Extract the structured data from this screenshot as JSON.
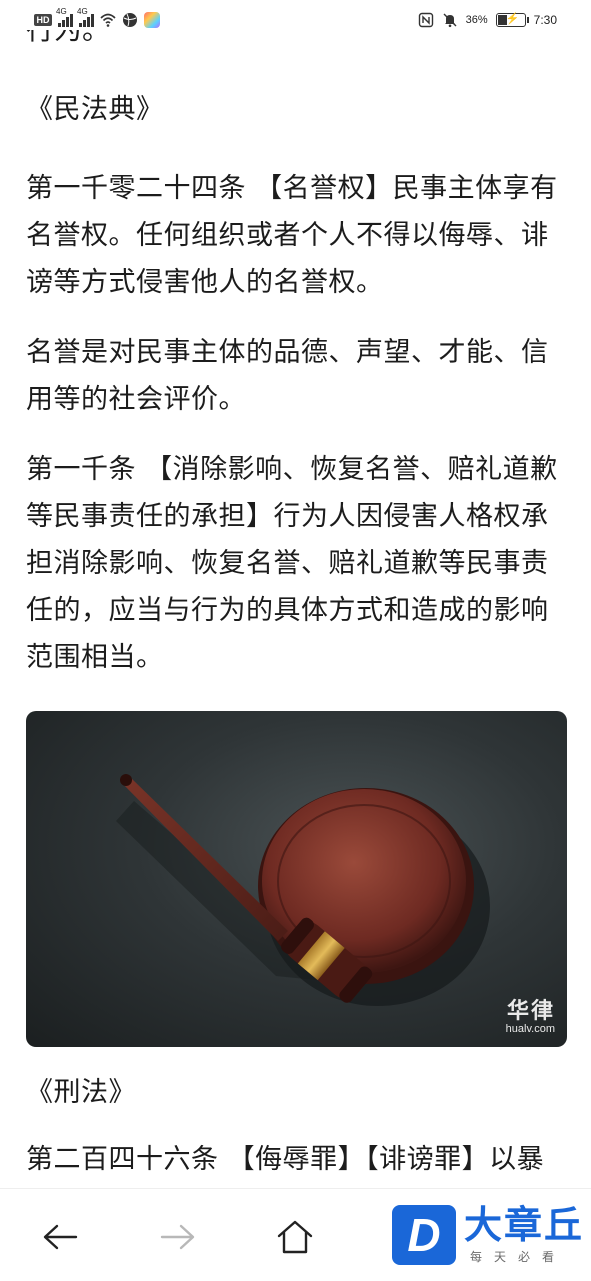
{
  "status_bar": {
    "hd_label": "HD",
    "sim1_label": "4G",
    "sim2_label": "4G",
    "battery_text": "36%",
    "time": "7:30"
  },
  "article": {
    "cut_text": "行为。",
    "book1": "《民法典》",
    "p1": "第一千零二十四条 【名誉权】民事主体享有名誉权。任何组织或者个人不得以侮辱、诽谤等方式侵害他人的名誉权。",
    "p2": "名誉是对民事主体的品德、声望、才能、信用等的社会评价。",
    "p3": "第一千条 【消除影响、恢复名誉、赔礼道歉等民事责任的承担】行为人因侵害人格权承担消除影响、恢复名誉、赔礼道歉等民事责任的，应当与行为的具体方式和造成的影响范围相当。",
    "image_watermark_cn": "华律",
    "image_watermark_en": "hualv.com",
    "book2": "《刑法》",
    "p4": "第二百四十六条 【侮辱罪】【诽谤罪】以暴力或者其他方法公然侮辱他人或者捏造"
  },
  "bottom_bar": {
    "back_icon": "arrow-left-icon",
    "forward_icon": "arrow-right-icon",
    "home_icon": "home-icon",
    "logo_letter": "D",
    "logo_name": "大章丘",
    "logo_slogan": "每天必看"
  }
}
